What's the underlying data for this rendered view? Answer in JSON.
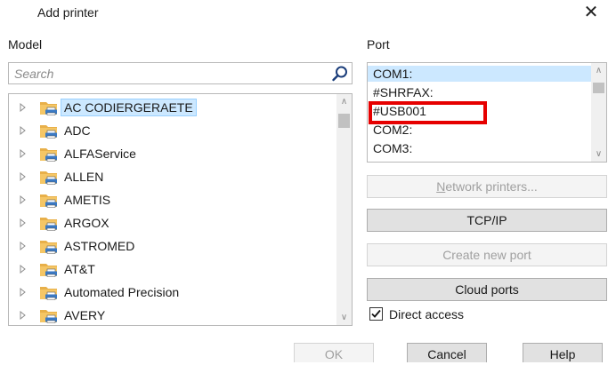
{
  "window": {
    "title": "Add printer"
  },
  "model": {
    "label": "Model",
    "search_placeholder": "Search",
    "items": [
      {
        "label": "AC CODIERGERAETE",
        "selected": true
      },
      {
        "label": "ADC"
      },
      {
        "label": "ALFAService"
      },
      {
        "label": "ALLEN"
      },
      {
        "label": "AMETIS"
      },
      {
        "label": "ARGOX"
      },
      {
        "label": "ASTROMED"
      },
      {
        "label": "AT&T"
      },
      {
        "label": "Automated Precision"
      },
      {
        "label": "AVERY"
      }
    ]
  },
  "port": {
    "label": "Port",
    "items": [
      {
        "label": "COM1:",
        "selected": true
      },
      {
        "label": "#SHRFAX:"
      },
      {
        "label": "#USB001"
      },
      {
        "label": "COM2:"
      },
      {
        "label": "COM3:"
      }
    ],
    "network_printers_prefix": "N",
    "network_printers_rest": "etwork printers...",
    "tcpip_label": "TCP/IP",
    "create_port_label": "Create new port",
    "cloud_ports_label": "Cloud ports",
    "direct_access_label": "Direct access",
    "direct_access_checked": true
  },
  "footer": {
    "ok_label": "OK",
    "cancel_label": "Cancel",
    "help_label": "Help"
  },
  "colors": {
    "selection": "#cce8ff",
    "highlight_box": "#e60000"
  }
}
